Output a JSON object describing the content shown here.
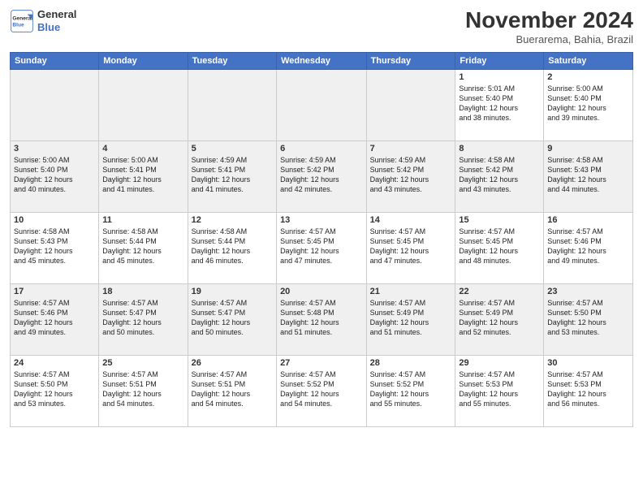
{
  "header": {
    "logo_line1": "General",
    "logo_line2": "Blue",
    "month_title": "November 2024",
    "location": "Buerarema, Bahia, Brazil"
  },
  "weekdays": [
    "Sunday",
    "Monday",
    "Tuesday",
    "Wednesday",
    "Thursday",
    "Friday",
    "Saturday"
  ],
  "weeks": [
    [
      {
        "day": "",
        "info": ""
      },
      {
        "day": "",
        "info": ""
      },
      {
        "day": "",
        "info": ""
      },
      {
        "day": "",
        "info": ""
      },
      {
        "day": "",
        "info": ""
      },
      {
        "day": "1",
        "info": "Sunrise: 5:01 AM\nSunset: 5:40 PM\nDaylight: 12 hours\nand 38 minutes."
      },
      {
        "day": "2",
        "info": "Sunrise: 5:00 AM\nSunset: 5:40 PM\nDaylight: 12 hours\nand 39 minutes."
      }
    ],
    [
      {
        "day": "3",
        "info": "Sunrise: 5:00 AM\nSunset: 5:40 PM\nDaylight: 12 hours\nand 40 minutes."
      },
      {
        "day": "4",
        "info": "Sunrise: 5:00 AM\nSunset: 5:41 PM\nDaylight: 12 hours\nand 41 minutes."
      },
      {
        "day": "5",
        "info": "Sunrise: 4:59 AM\nSunset: 5:41 PM\nDaylight: 12 hours\nand 41 minutes."
      },
      {
        "day": "6",
        "info": "Sunrise: 4:59 AM\nSunset: 5:42 PM\nDaylight: 12 hours\nand 42 minutes."
      },
      {
        "day": "7",
        "info": "Sunrise: 4:59 AM\nSunset: 5:42 PM\nDaylight: 12 hours\nand 43 minutes."
      },
      {
        "day": "8",
        "info": "Sunrise: 4:58 AM\nSunset: 5:42 PM\nDaylight: 12 hours\nand 43 minutes."
      },
      {
        "day": "9",
        "info": "Sunrise: 4:58 AM\nSunset: 5:43 PM\nDaylight: 12 hours\nand 44 minutes."
      }
    ],
    [
      {
        "day": "10",
        "info": "Sunrise: 4:58 AM\nSunset: 5:43 PM\nDaylight: 12 hours\nand 45 minutes."
      },
      {
        "day": "11",
        "info": "Sunrise: 4:58 AM\nSunset: 5:44 PM\nDaylight: 12 hours\nand 45 minutes."
      },
      {
        "day": "12",
        "info": "Sunrise: 4:58 AM\nSunset: 5:44 PM\nDaylight: 12 hours\nand 46 minutes."
      },
      {
        "day": "13",
        "info": "Sunrise: 4:57 AM\nSunset: 5:45 PM\nDaylight: 12 hours\nand 47 minutes."
      },
      {
        "day": "14",
        "info": "Sunrise: 4:57 AM\nSunset: 5:45 PM\nDaylight: 12 hours\nand 47 minutes."
      },
      {
        "day": "15",
        "info": "Sunrise: 4:57 AM\nSunset: 5:45 PM\nDaylight: 12 hours\nand 48 minutes."
      },
      {
        "day": "16",
        "info": "Sunrise: 4:57 AM\nSunset: 5:46 PM\nDaylight: 12 hours\nand 49 minutes."
      }
    ],
    [
      {
        "day": "17",
        "info": "Sunrise: 4:57 AM\nSunset: 5:46 PM\nDaylight: 12 hours\nand 49 minutes."
      },
      {
        "day": "18",
        "info": "Sunrise: 4:57 AM\nSunset: 5:47 PM\nDaylight: 12 hours\nand 50 minutes."
      },
      {
        "day": "19",
        "info": "Sunrise: 4:57 AM\nSunset: 5:47 PM\nDaylight: 12 hours\nand 50 minutes."
      },
      {
        "day": "20",
        "info": "Sunrise: 4:57 AM\nSunset: 5:48 PM\nDaylight: 12 hours\nand 51 minutes."
      },
      {
        "day": "21",
        "info": "Sunrise: 4:57 AM\nSunset: 5:49 PM\nDaylight: 12 hours\nand 51 minutes."
      },
      {
        "day": "22",
        "info": "Sunrise: 4:57 AM\nSunset: 5:49 PM\nDaylight: 12 hours\nand 52 minutes."
      },
      {
        "day": "23",
        "info": "Sunrise: 4:57 AM\nSunset: 5:50 PM\nDaylight: 12 hours\nand 53 minutes."
      }
    ],
    [
      {
        "day": "24",
        "info": "Sunrise: 4:57 AM\nSunset: 5:50 PM\nDaylight: 12 hours\nand 53 minutes."
      },
      {
        "day": "25",
        "info": "Sunrise: 4:57 AM\nSunset: 5:51 PM\nDaylight: 12 hours\nand 54 minutes."
      },
      {
        "day": "26",
        "info": "Sunrise: 4:57 AM\nSunset: 5:51 PM\nDaylight: 12 hours\nand 54 minutes."
      },
      {
        "day": "27",
        "info": "Sunrise: 4:57 AM\nSunset: 5:52 PM\nDaylight: 12 hours\nand 54 minutes."
      },
      {
        "day": "28",
        "info": "Sunrise: 4:57 AM\nSunset: 5:52 PM\nDaylight: 12 hours\nand 55 minutes."
      },
      {
        "day": "29",
        "info": "Sunrise: 4:57 AM\nSunset: 5:53 PM\nDaylight: 12 hours\nand 55 minutes."
      },
      {
        "day": "30",
        "info": "Sunrise: 4:57 AM\nSunset: 5:53 PM\nDaylight: 12 hours\nand 56 minutes."
      }
    ]
  ]
}
